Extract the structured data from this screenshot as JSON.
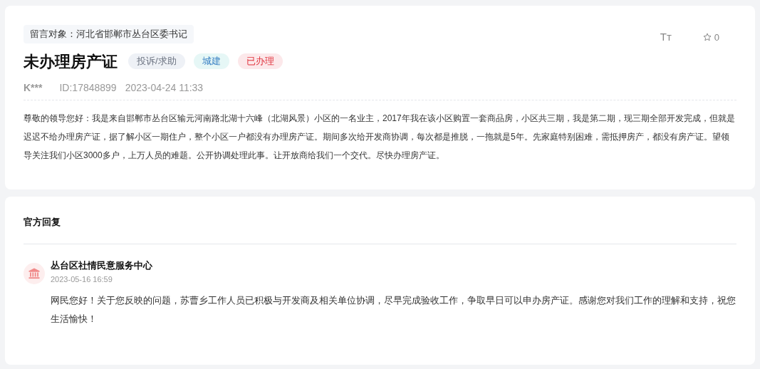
{
  "message": {
    "recipient": "留言对象：河北省邯郸市丛台区委书记",
    "title": "未办理房产证",
    "tags": [
      {
        "label": "投诉/求助",
        "kind": "type",
        "color": "#eef1f6"
      },
      {
        "label": "城建",
        "kind": "category",
        "color": "#e6f7f6"
      },
      {
        "label": "已办理",
        "kind": "status",
        "color": "#fce8ea"
      }
    ],
    "font_size_button": "Tт",
    "star_count": "0",
    "author": "K***",
    "id": "ID:17848899",
    "time": "2023-04-24 11:33",
    "body": "尊敬的领导您好：我是来自邯郸市丛台区输元河南路北湖十六峰（北湖风景）小区的一名业主，2017年我在该小区购置一套商品房，小区共三期，我是第二期，现三期全部开发完成，但就是迟迟不给办理房产证，据了解小区一期住户，整个小区一户都没有办理房产证。期间多次给开发商协调，每次都是推脱，一拖就是5年。先家庭特别困难，需抵押房产，都没有房产证。望领导关注我们小区3000多户，上万人员的难题。公开协调处理此事。让开放商给我们一个交代。尽快办理房产证。"
  },
  "reply": {
    "heading": "官方回复",
    "org": "丛台区社情民意服务中心",
    "time": "2023-05-16 16:59",
    "body": "网民您好！关于您反映的问题，苏曹乡工作人员已积极与开发商及相关单位协调，尽早完成验收工作，争取早日可以申办房产证。感谢您对我们工作的理解和支持，祝您生活愉快！"
  }
}
